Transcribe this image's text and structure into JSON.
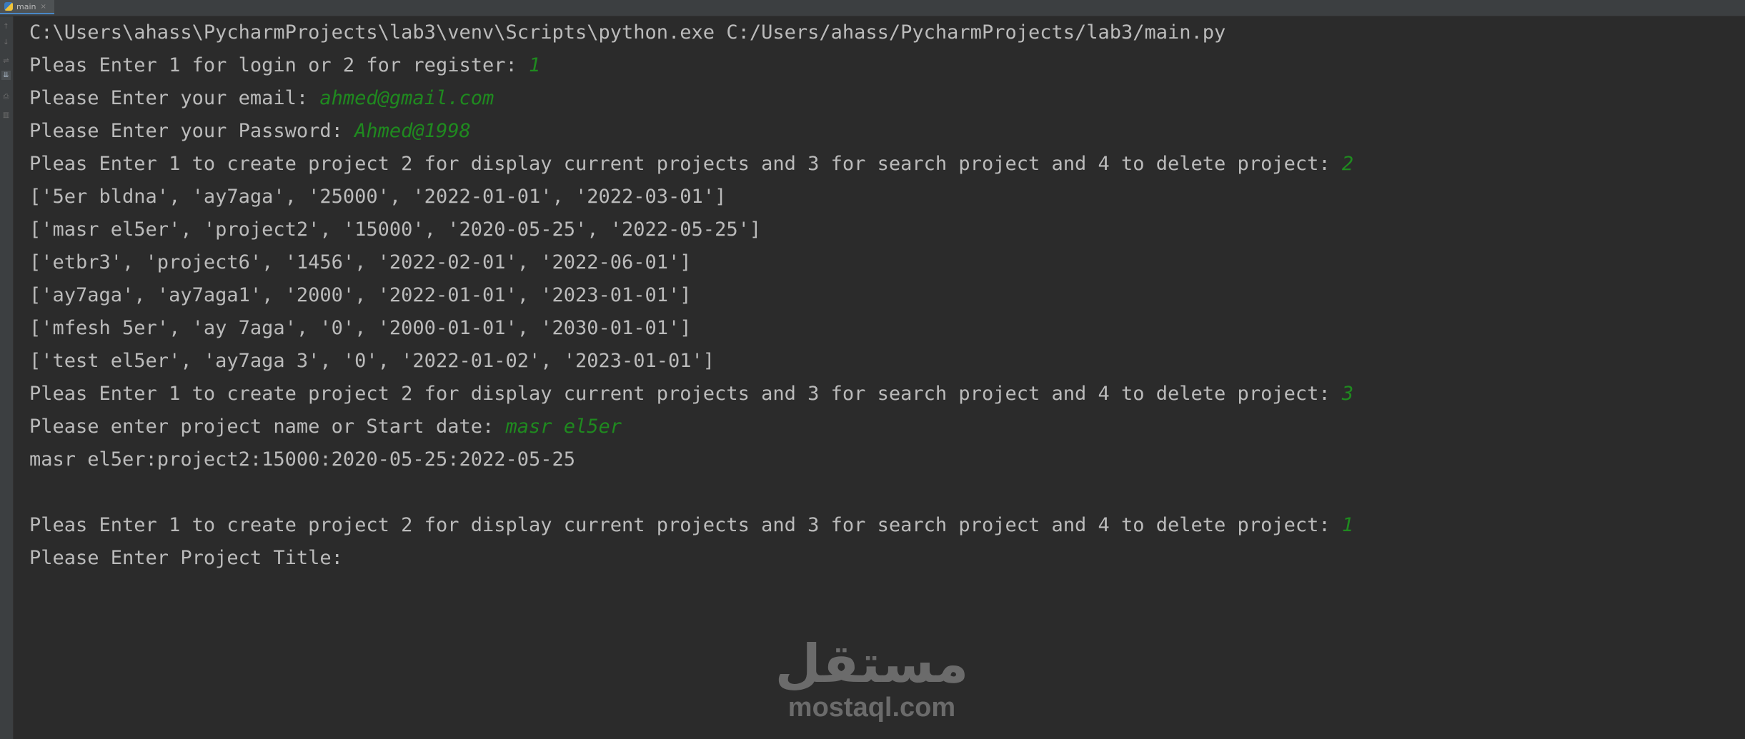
{
  "tab": {
    "label": "main",
    "close": "×"
  },
  "gutter": {
    "icons": [
      "up-arrow",
      "down-arrow",
      "soft-wrap",
      "scroll-to-end",
      "print",
      "trash"
    ]
  },
  "colors": {
    "background": "#2b2b2b",
    "output_text": "#bbbbbb",
    "user_input": "#1f8a1f"
  },
  "console": {
    "command": "C:\\Users\\ahass\\PycharmProjects\\lab3\\venv\\Scripts\\python.exe C:/Users/ahass/PycharmProjects/lab3/main.py",
    "login_prompt": "Pleas Enter 1 for login or 2 for register: ",
    "login_input": "1",
    "email_prompt": "Please Enter your email: ",
    "email_input": "ahmed@gmail.com",
    "password_prompt": "Please Enter your Password: ",
    "password_input": "Ahmed@1998",
    "menu_prompt_1": "Pleas Enter 1 to create project 2 for display current projects and 3 for search project and 4 to delete project: ",
    "menu_input_1": "2",
    "projects": [
      "['5er bldna', 'ay7aga', '25000', '2022-01-01', '2022-03-01']",
      "['masr el5er', 'project2', '15000', '2020-05-25', '2022-05-25']",
      "['etbr3', 'project6', '1456', '2022-02-01', '2022-06-01']",
      "['ay7aga', 'ay7aga1', '2000', '2022-01-01', '2023-01-01']",
      "['mfesh 5er', 'ay 7aga', '0', '2000-01-01', '2030-01-01']",
      "['test el5er', 'ay7aga 3', '0', '2022-01-02', '2023-01-01']"
    ],
    "menu_prompt_2": "Pleas Enter 1 to create project 2 for display current projects and 3 for search project and 4 to delete project: ",
    "menu_input_2": "3",
    "search_prompt": "Please enter project name or Start date: ",
    "search_input": "masr el5er",
    "search_result": "masr el5er:project2:15000:2020-05-25:2022-05-25",
    "menu_prompt_3": "Pleas Enter 1 to create project 2 for display current projects and 3 for search project and 4 to delete project: ",
    "menu_input_3": "1",
    "title_prompt": "Please Enter Project Title:"
  },
  "watermark": {
    "arabic": "مستقل",
    "latin": "mostaql.com"
  }
}
